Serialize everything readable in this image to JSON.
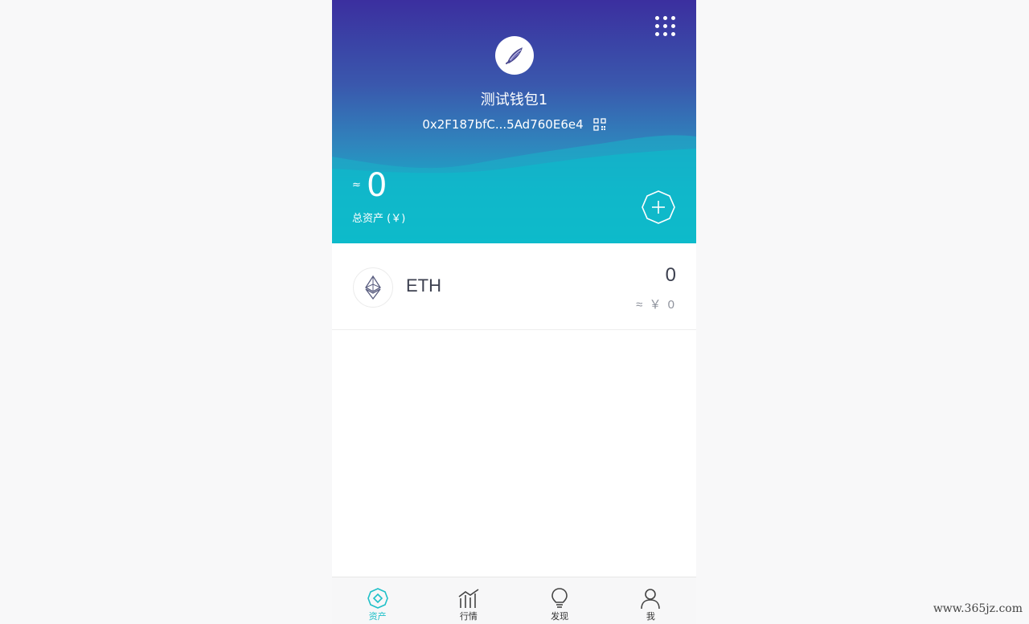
{
  "header": {
    "wallet_name": "测试钱包1",
    "address": "0x2F187bfC...5Ad760E6e4",
    "approx_symbol": "≈",
    "total_value": "0",
    "total_label": "总资产 (￥)"
  },
  "assets": [
    {
      "symbol": "ETH",
      "amount": "0",
      "fiat": "≈ ￥ 0",
      "icon": "ethereum-icon"
    }
  ],
  "tabbar": {
    "tabs": [
      {
        "label": "资产",
        "icon": "asset-icon",
        "active": true
      },
      {
        "label": "行情",
        "icon": "market-chart-icon",
        "active": false
      },
      {
        "label": "发现",
        "icon": "lightbulb-icon",
        "active": false
      },
      {
        "label": "我",
        "icon": "user-icon",
        "active": false
      }
    ]
  },
  "watermark": "www.365jz.com",
  "colors": {
    "accent": "#1fc0c8",
    "header_top": "#3b2f9f",
    "header_bottom": "#06bfcc",
    "text_dark": "#3d4150",
    "text_muted": "#8e929c"
  }
}
